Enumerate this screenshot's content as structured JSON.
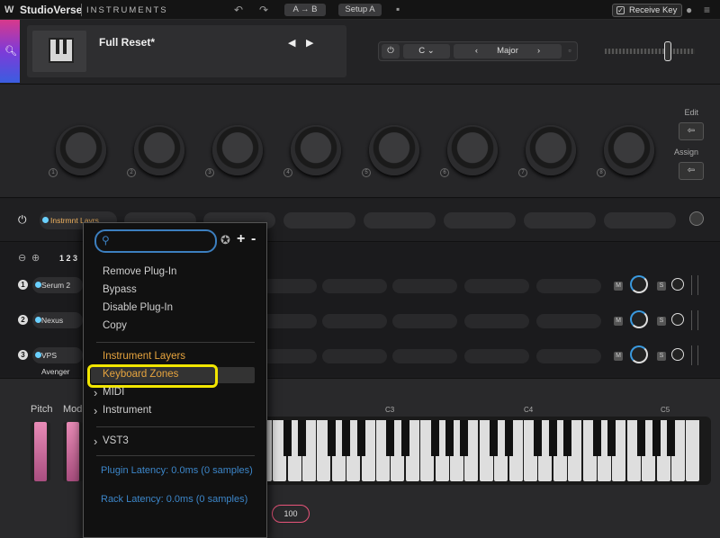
{
  "topbar": {
    "brand": "StudioVerse",
    "brand_sub": "INSTRUMENTS",
    "undo_icon": "undo-icon",
    "redo_icon": "redo-icon",
    "ab_label": "A → B",
    "setup_label": "Setup A",
    "receive_key_label": "Receive Key"
  },
  "header": {
    "preset_name": "Full Reset*",
    "key": "C",
    "scale": "Major"
  },
  "macros": {
    "numbers": [
      "1",
      "2",
      "3",
      "4",
      "5",
      "6",
      "7",
      "8"
    ],
    "edit_label": "Edit",
    "assign_label": "Assign"
  },
  "rack": {
    "layer_chip_label": "Instrmnt Layrs",
    "pages": "1 2 3"
  },
  "layers": [
    {
      "index": "1",
      "name": "Serum 2"
    },
    {
      "index": "2",
      "name": "Nexus"
    },
    {
      "index": "3",
      "name": "VPS Avenger"
    }
  ],
  "keyboard": {
    "pitch_label": "Pitch",
    "mod_label": "Mod",
    "octaves": [
      "C3",
      "C4",
      "C5"
    ],
    "velocity": "100"
  },
  "menu": {
    "search_placeholder": "",
    "items": {
      "remove": "Remove Plug-In",
      "bypass": "Bypass",
      "disable": "Disable Plug-In",
      "copy": "Copy",
      "instrument_layers": "Instrument Layers",
      "keyboard_zones": "Keyboard Zones",
      "midi": "MIDI",
      "instrument": "Instrument",
      "vst3": "VST3"
    },
    "plugin_latency": "Plugin Latency: 0.0ms (0 samples)",
    "rack_latency": "Rack Latency: 0.0ms (0 samples)"
  },
  "colors": {
    "accent_blue": "#3c7fbf",
    "orange": "#e7a43e",
    "highlight_yellow": "#f2e600"
  }
}
